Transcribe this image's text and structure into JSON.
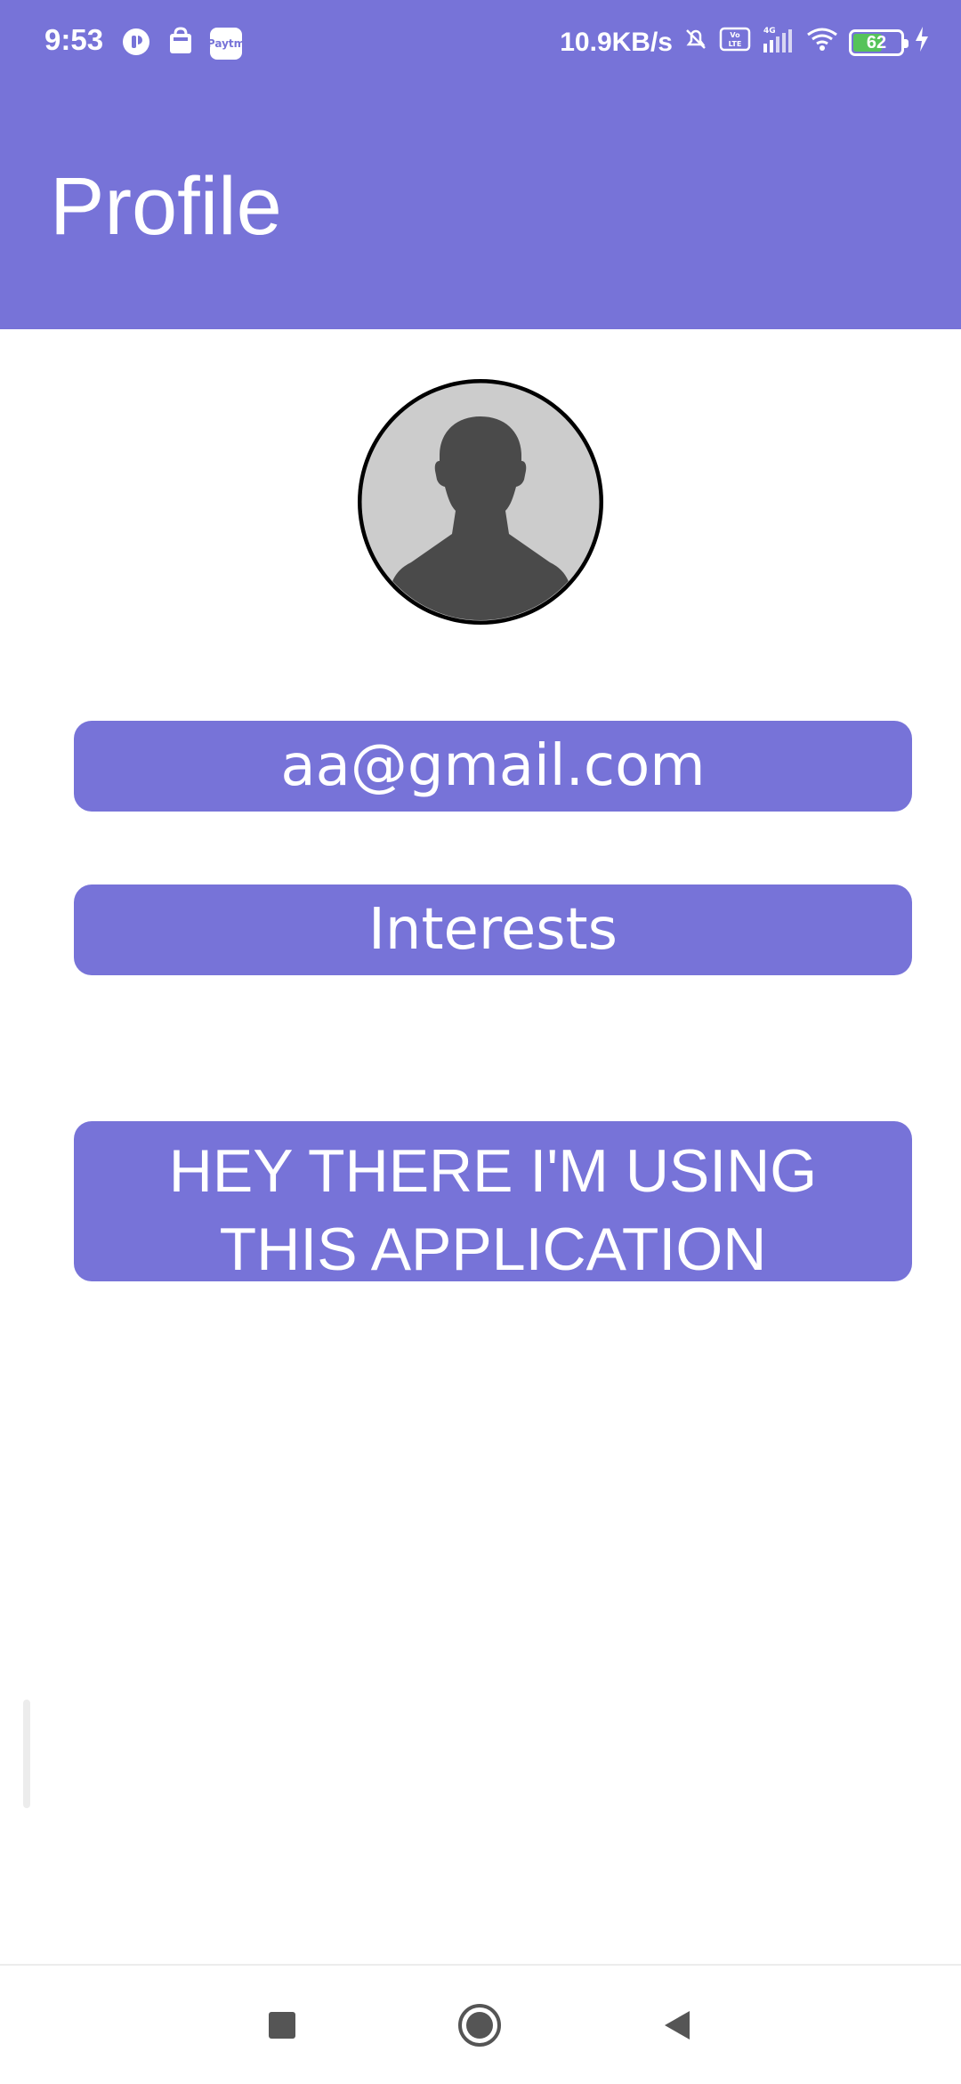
{
  "status_bar": {
    "time": "9:53",
    "left_icons": [
      "sync-icon",
      "shopping-bag-icon",
      "paytm-icon"
    ],
    "paytm_label": "Paytm",
    "network_speed": "10.9KB/s",
    "right_icons": [
      "mute-icon",
      "volte-icon",
      "signal-icon",
      "wifi-icon",
      "battery-icon",
      "charging-icon"
    ],
    "volte_label": "Vo LTE",
    "network_type": "4G",
    "battery": 62,
    "battery_label": "62"
  },
  "app_bar": {
    "title": "Profile"
  },
  "profile": {
    "avatar_icon": "default-avatar-icon",
    "email": "aa@gmail.com",
    "interests_label": "Interests",
    "status_message": "HEY THERE I'M USING THIS APPLICATION"
  },
  "nav_bar": {
    "icons": [
      "recent-apps-icon",
      "home-icon",
      "back-icon"
    ]
  },
  "colors": {
    "primary": "#7773d8",
    "background": "#ffffff",
    "avatar_bg": "#cccccc",
    "avatar_figure": "#4a4a4a",
    "battery_fill": "#56c35a"
  }
}
